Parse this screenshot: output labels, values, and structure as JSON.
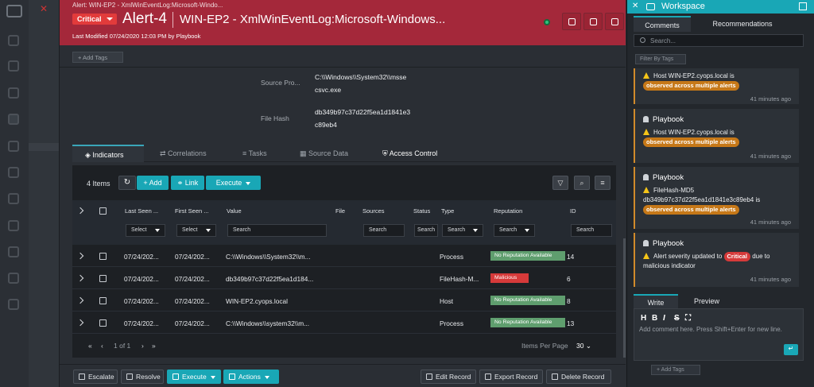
{
  "header": {
    "breadcrumb": "Alert: WIN-EP2 - XmlWinEventLog:Microsoft-Windo...",
    "severity": "Critical",
    "alert_id": "Alert-4",
    "alert_title": "WIN-EP2 - XmlWinEventLog:Microsoft-Windows...",
    "last_modified": "Last Modified 07/24/2020 12:03 PM by Playbook",
    "brand_color": "#a4283a"
  },
  "tags": {
    "add_label": "+ Add Tags"
  },
  "details": {
    "source_process_label": "Source Pro...",
    "source_process_value_1": "C:\\\\Windows\\\\System32\\\\msse",
    "source_process_value_2": "csvc.exe",
    "file_hash_label": "File Hash",
    "file_hash_value_1": "db349b97c37d22f5ea1d1841e3",
    "file_hash_value_2": "c89eb4"
  },
  "tabs": [
    {
      "label": "Indicators",
      "icon": "tag-icon"
    },
    {
      "label": "Correlations",
      "icon": "correlations-icon"
    },
    {
      "label": "Tasks",
      "icon": "tasks-icon"
    },
    {
      "label": "Source Data",
      "icon": "grid-icon"
    },
    {
      "label": "Access Control",
      "icon": "shield-icon"
    }
  ],
  "indicators": {
    "count": "4 Items",
    "add_label": "Add",
    "link_label": "Link",
    "execute_label": "Execute",
    "columns": [
      "Last Seen ...",
      "First Seen ...",
      "Value",
      "File",
      "Sources",
      "Status",
      "Type",
      "Reputation",
      "ID"
    ],
    "filters": {
      "last_seen": "Select",
      "first_seen": "Select",
      "value": "Search",
      "sources": "Search",
      "status": "Search",
      "type": "Search",
      "reputation": "Search",
      "id": "Search"
    },
    "rows": [
      {
        "last_seen": "07/24/202...",
        "first_seen": "07/24/202...",
        "value": "C:\\\\Windows\\\\System32\\\\m...",
        "type": "Process",
        "reputation": "No Reputation Available",
        "id": "14"
      },
      {
        "last_seen": "07/24/202...",
        "first_seen": "07/24/202...",
        "value": "db349b97c37d22f5ea1d184...",
        "type": "FileHash-M...",
        "reputation": "Malicious",
        "id": "6"
      },
      {
        "last_seen": "07/24/202...",
        "first_seen": "07/24/202...",
        "value": "WIN-EP2.cyops.local",
        "type": "Host",
        "reputation": "No Reputation Available",
        "id": "8"
      },
      {
        "last_seen": "07/24/202...",
        "first_seen": "07/24/202...",
        "value": "C:\\\\Windows\\\\system32\\\\m...",
        "type": "Process",
        "reputation": "No Reputation Available",
        "id": "13"
      }
    ],
    "pager": {
      "text": "1 of 1",
      "items_per_page_label": "Items Per Page",
      "items_per_page": "30"
    },
    "colors": {
      "no_reputation": "#5f9e6e",
      "malicious": "#d63a3a",
      "accent": "#19a7b6"
    }
  },
  "footer": {
    "escalate": "Escalate",
    "resolve": "Resolve",
    "execute": "Execute",
    "actions": "Actions",
    "edit_record": "Edit Record",
    "export_record": "Export Record",
    "delete_record": "Delete Record"
  },
  "workspace": {
    "title": "Workspace",
    "tab_comments": "Comments",
    "tab_recommendations": "Recommendations",
    "search_placeholder": "Search...",
    "filter_tags": "Filter By Tags",
    "cards": [
      {
        "author": "",
        "line1": "Host WIN-EP2.cyops.local is",
        "badge": "observed across multiple alerts",
        "time": "41 minutes ago"
      },
      {
        "author": "Playbook",
        "line1": "Host WIN-EP2.cyops.local is",
        "badge": "observed across multiple alerts",
        "time": "41 minutes ago"
      },
      {
        "author": "Playbook",
        "line1": "FileHash-MD5",
        "line2": "db349b97c37d22f5ea1d1841e3c89eb4 is",
        "badge": "observed across multiple alerts",
        "time": "41 minutes ago"
      },
      {
        "author": "Playbook",
        "line1_pre": "Alert severity updated to",
        "badge": "Critical",
        "line1_post": "due to",
        "line2": "malicious indicator",
        "time": "41 minutes ago"
      }
    ],
    "write_tab": "Write",
    "preview_tab": "Preview",
    "comment_placeholder": "Add comment here. Press Shift+Enter for new line.",
    "add_tags": "+ Add Tags",
    "accent": "#19a7b6",
    "badge_color": "#c67818"
  }
}
